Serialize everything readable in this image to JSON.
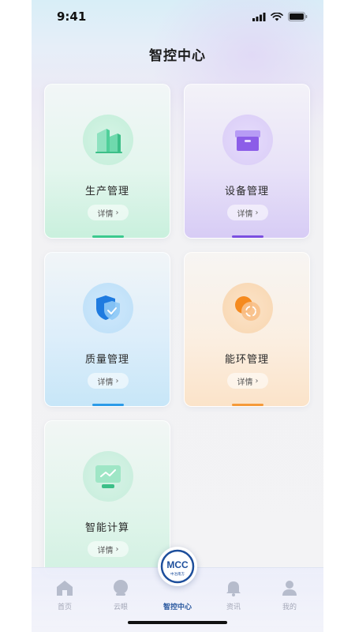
{
  "status_bar": {
    "time": "9:41"
  },
  "header": {
    "title": "智控中心"
  },
  "cards": [
    {
      "title": "生产管理",
      "detail_label": "详情",
      "accent": "#3cc98e"
    },
    {
      "title": "设备管理",
      "detail_label": "详情",
      "accent": "#7b4fe0"
    },
    {
      "title": "质量管理",
      "detail_label": "详情",
      "accent": "#2b9ae8"
    },
    {
      "title": "能环管理",
      "detail_label": "详情",
      "accent": "#f59a3a"
    },
    {
      "title": "智能计算",
      "detail_label": "详情",
      "accent": "#3cc98e"
    }
  ],
  "tab_bar": {
    "items": [
      {
        "label": "首页",
        "icon": "home-icon"
      },
      {
        "label": "云眼",
        "icon": "user-circle-icon"
      },
      {
        "label": "智控中心",
        "icon": "mcc-logo",
        "active": true
      },
      {
        "label": "资讯",
        "icon": "bell-icon"
      },
      {
        "label": "我的",
        "icon": "person-icon"
      }
    ],
    "logo_text": "MCC",
    "logo_subtext": "中冶南方"
  },
  "colors": {
    "active_tab": "#2c5aa0",
    "inactive_tab": "#a4a8b8"
  }
}
